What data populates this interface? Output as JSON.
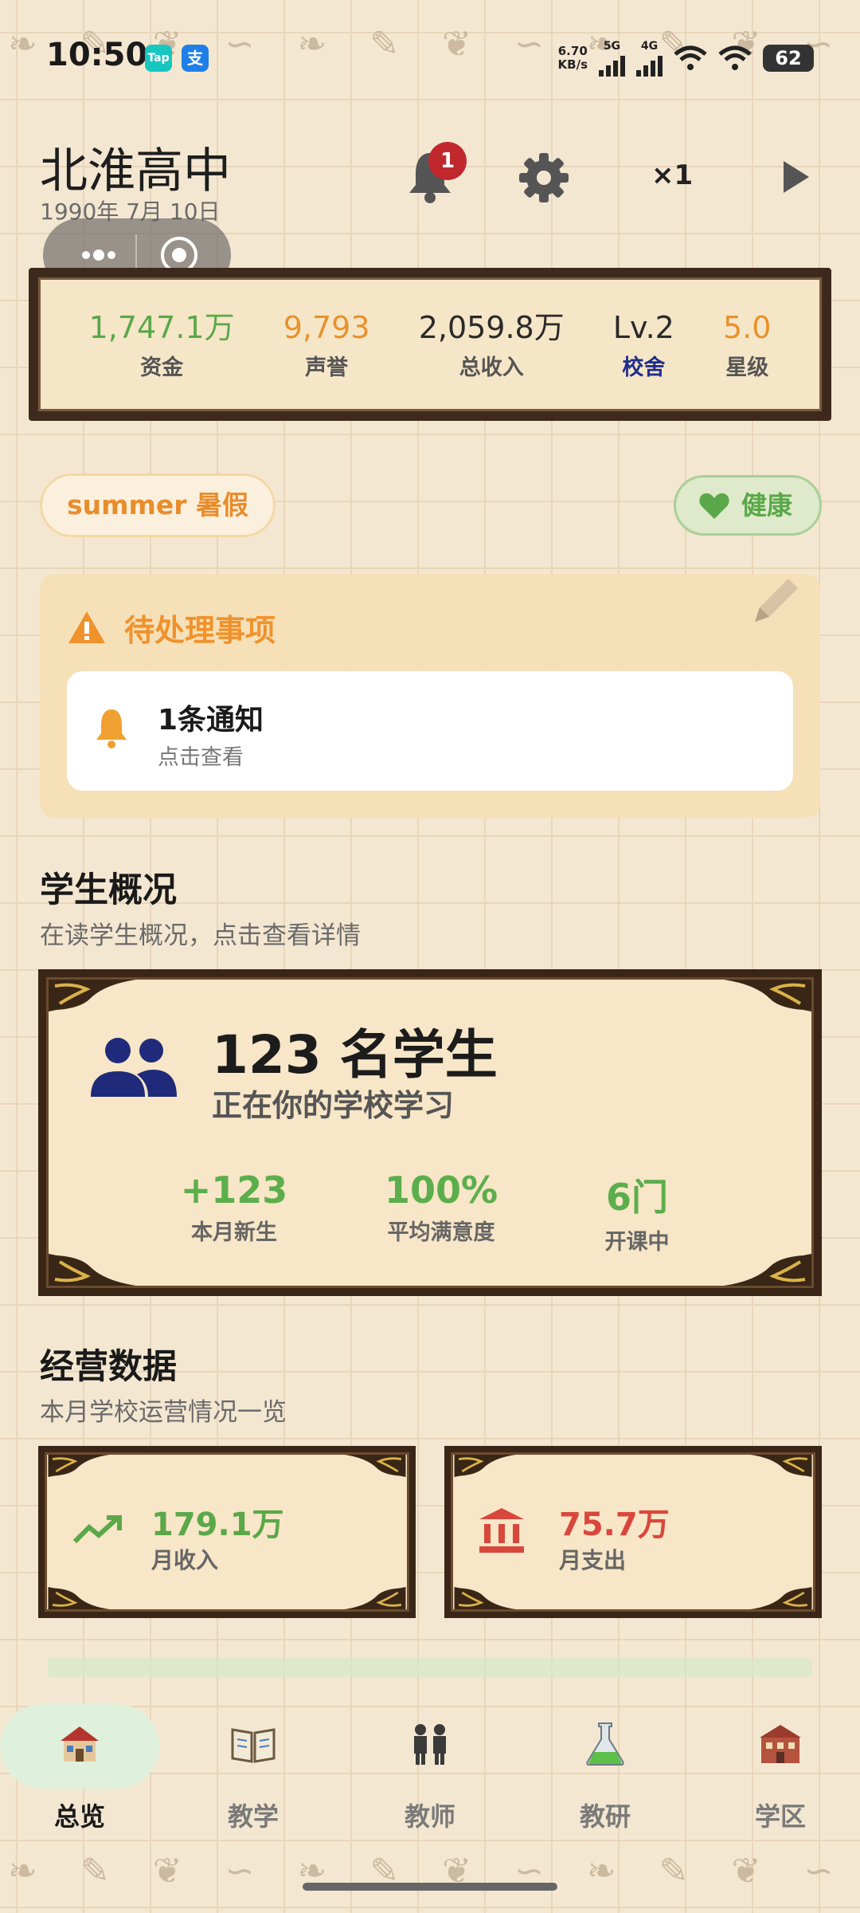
{
  "status_bar": {
    "time": "10:50",
    "net_speed_value": "6.70",
    "net_speed_unit": "KB/s",
    "signal1": "5G",
    "signal2": "4G",
    "battery": "62",
    "app_badges": [
      "Tap",
      "支"
    ]
  },
  "header": {
    "school_name": "北淮高中",
    "date": "1990年 7月 10日",
    "notification_count": "1",
    "speed": "×1"
  },
  "stats": [
    {
      "value": "1,747.1万",
      "label": "资金",
      "value_color": "#5aa849",
      "label_color": "#555555"
    },
    {
      "value": "9,793",
      "label": "声誉",
      "value_color": "#e8922c",
      "label_color": "#555555"
    },
    {
      "value": "2,059.8万",
      "label": "总收入",
      "value_color": "#2a2a2a",
      "label_color": "#555555"
    },
    {
      "value": "Lv.2",
      "label": "校舍",
      "value_color": "#2a2a2a",
      "label_color": "#1f2d8a"
    },
    {
      "value": "5.0",
      "label": "星级",
      "value_color": "#e8922c",
      "label_color": "#555555"
    }
  ],
  "season": "summer 暑假",
  "health": "健康",
  "pending": {
    "title": "待处理事项",
    "notice_title": "1条通知",
    "notice_sub": "点击查看"
  },
  "students": {
    "section_title": "学生概况",
    "section_sub": "在读学生概况，点击查看详情",
    "count": "123 名学生",
    "sub": "正在你的学校学习",
    "metrics": [
      {
        "value": "+123",
        "label": "本月新生"
      },
      {
        "value": "100%",
        "label": "平均满意度"
      },
      {
        "value": "6门",
        "label": "开课中"
      }
    ]
  },
  "operations": {
    "section_title": "经营数据",
    "section_sub": "本月学校运营情况一览",
    "income_value": "179.1万",
    "income_label": "月收入",
    "expense_value": "75.7万",
    "expense_label": "月支出"
  },
  "nav": [
    {
      "label": "总览",
      "icon": "school-house-icon",
      "active": true
    },
    {
      "label": "教学",
      "icon": "book-icon",
      "active": false
    },
    {
      "label": "教师",
      "icon": "teachers-icon",
      "active": false
    },
    {
      "label": "教研",
      "icon": "flask-icon",
      "active": false
    },
    {
      "label": "学区",
      "icon": "campus-building-icon",
      "active": false
    }
  ],
  "colors": {
    "accent_orange": "#f0922c",
    "accent_green": "#5aa849",
    "accent_red": "#d9473c",
    "frame_brown": "#3a2616",
    "paper": "#f7e6c7"
  }
}
